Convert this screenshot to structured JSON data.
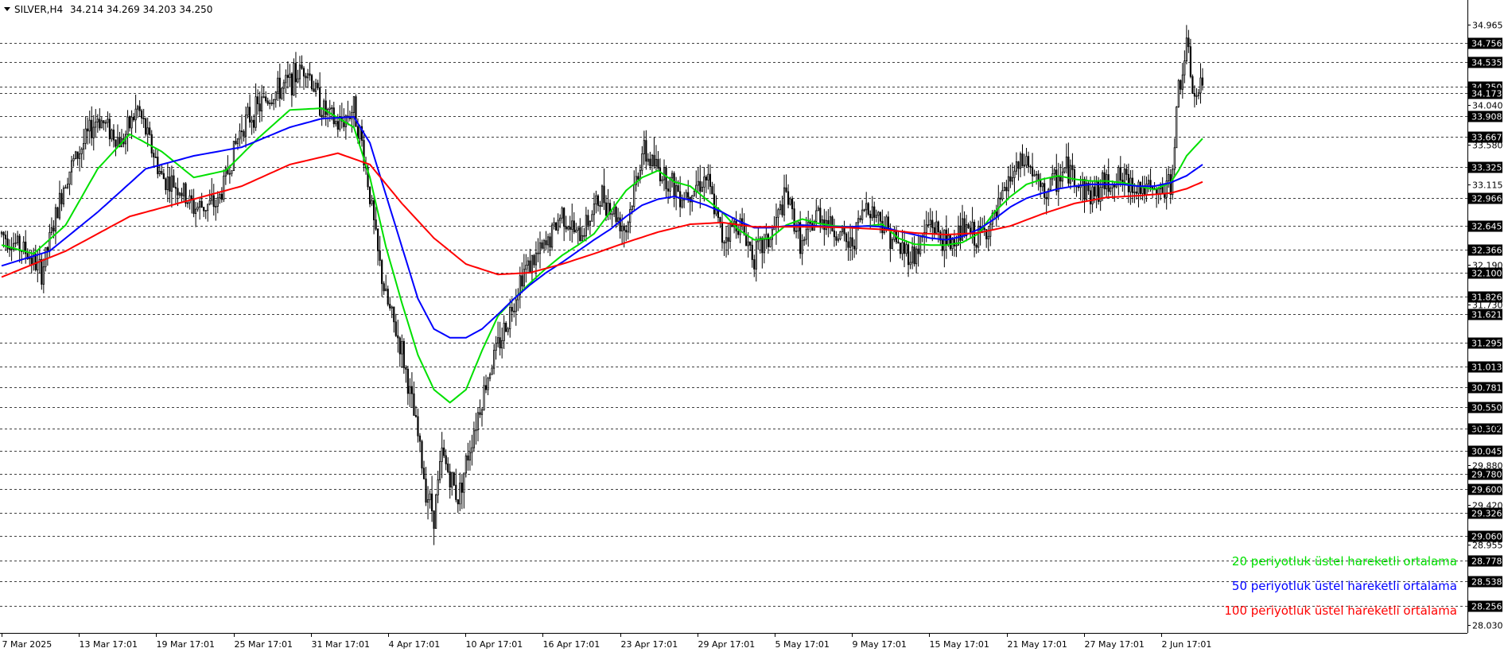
{
  "header": {
    "symbol": "SILVER,H4",
    "ohlc": "34.214 34.269 34.203 34.250"
  },
  "colors": {
    "ema20": "#00e000",
    "ema50": "#0000ff",
    "ema100": "#ff0000",
    "candle": "#000000",
    "grid": "#000000",
    "label_bg": "#000000"
  },
  "chart_data": {
    "type": "candlestick",
    "title": "SILVER,H4",
    "ylim": [
      27.94,
      35.25
    ],
    "grid": true,
    "price_ticks": [
      "34.965",
      "34.040",
      "33.580",
      "33.115",
      "32.190",
      "31.730",
      "30.315",
      "29.880",
      "29.420",
      "28.955",
      "28.030"
    ],
    "level_lines": [
      "34.756",
      "34.535",
      "34.250",
      "34.173",
      "33.908",
      "33.667",
      "33.325",
      "32.966",
      "32.645",
      "32.366",
      "32.100",
      "31.826",
      "31.621",
      "31.295",
      "31.013",
      "30.781",
      "30.550",
      "30.302",
      "30.045",
      "29.780",
      "29.600",
      "29.326",
      "29.060",
      "28.778",
      "28.538",
      "28.256"
    ],
    "time_ticks": [
      "7 Mar 2025",
      "13 Mar 17:01",
      "19 Mar 17:01",
      "25 Mar 17:01",
      "31 Mar 17:01",
      "4 Apr 17:01",
      "10 Apr 17:01",
      "16 Apr 17:01",
      "23 Apr 17:01",
      "29 Apr 17:01",
      "5 May 17:01",
      "9 May 17:01",
      "15 May 17:01",
      "21 May 17:01",
      "27 May 17:01",
      "2 Jun 17:01"
    ],
    "price_path": [
      [
        0,
        32.55
      ],
      [
        3,
        32.35
      ],
      [
        5,
        32.1
      ],
      [
        8,
        33.2
      ],
      [
        12,
        33.9
      ],
      [
        15,
        33.6
      ],
      [
        17,
        34.0
      ],
      [
        20,
        33.2
      ],
      [
        22,
        33.1
      ],
      [
        24,
        32.85
      ],
      [
        27,
        32.9
      ],
      [
        30,
        33.8
      ],
      [
        33,
        34.1
      ],
      [
        36,
        34.3
      ],
      [
        38,
        34.5
      ],
      [
        40,
        34.0
      ],
      [
        42,
        33.8
      ],
      [
        44,
        34.0
      ],
      [
        45,
        33.6
      ],
      [
        46,
        33.0
      ],
      [
        47,
        32.3
      ],
      [
        48,
        31.8
      ],
      [
        50,
        31.2
      ],
      [
        52,
        30.2
      ],
      [
        53,
        29.6
      ],
      [
        54,
        29.3
      ],
      [
        55,
        30.0
      ],
      [
        57,
        29.5
      ],
      [
        59,
        30.3
      ],
      [
        61,
        31.0
      ],
      [
        63,
        31.5
      ],
      [
        65,
        32.1
      ],
      [
        68,
        32.4
      ],
      [
        70,
        32.8
      ],
      [
        72,
        32.5
      ],
      [
        75,
        33.0
      ],
      [
        78,
        32.6
      ],
      [
        80,
        33.5
      ],
      [
        82,
        33.3
      ],
      [
        85,
        33.0
      ],
      [
        88,
        33.2
      ],
      [
        90,
        32.5
      ],
      [
        92,
        32.7
      ],
      [
        94,
        32.3
      ],
      [
        96,
        32.5
      ],
      [
        98,
        33.0
      ],
      [
        100,
        32.4
      ],
      [
        102,
        32.8
      ],
      [
        104,
        32.6
      ],
      [
        106,
        32.4
      ],
      [
        108,
        32.9
      ],
      [
        110,
        32.7
      ],
      [
        112,
        32.4
      ],
      [
        114,
        32.3
      ],
      [
        116,
        32.7
      ],
      [
        118,
        32.4
      ],
      [
        120,
        32.6
      ],
      [
        122,
        32.5
      ],
      [
        124,
        32.7
      ],
      [
        126,
        33.2
      ],
      [
        128,
        33.4
      ],
      [
        130,
        33.0
      ],
      [
        133,
        33.3
      ],
      [
        136,
        33.0
      ],
      [
        139,
        33.2
      ],
      [
        142,
        33.1
      ],
      [
        144,
        33.0
      ],
      [
        146,
        33.1
      ],
      [
        147,
        34.2
      ],
      [
        148,
        34.7
      ],
      [
        149,
        34.1
      ],
      [
        150,
        34.25
      ]
    ],
    "ema_series": [
      {
        "name": "20 periyotluk üstel hareketli ortalama",
        "color": "#00e000",
        "points": [
          [
            0,
            32.42
          ],
          [
            4,
            32.32
          ],
          [
            8,
            32.65
          ],
          [
            12,
            33.3
          ],
          [
            16,
            33.7
          ],
          [
            20,
            33.5
          ],
          [
            24,
            33.2
          ],
          [
            28,
            33.28
          ],
          [
            32,
            33.65
          ],
          [
            36,
            33.98
          ],
          [
            40,
            34.0
          ],
          [
            44,
            33.78
          ],
          [
            46,
            33.2
          ],
          [
            48,
            32.4
          ],
          [
            50,
            31.75
          ],
          [
            52,
            31.15
          ],
          [
            54,
            30.75
          ],
          [
            56,
            30.6
          ],
          [
            58,
            30.75
          ],
          [
            60,
            31.2
          ],
          [
            62,
            31.6
          ],
          [
            64,
            31.8
          ],
          [
            66,
            31.98
          ],
          [
            68,
            32.15
          ],
          [
            70,
            32.3
          ],
          [
            72,
            32.42
          ],
          [
            74,
            32.55
          ],
          [
            76,
            32.8
          ],
          [
            78,
            33.05
          ],
          [
            80,
            33.2
          ],
          [
            82,
            33.28
          ],
          [
            84,
            33.15
          ],
          [
            86,
            33.1
          ],
          [
            88,
            32.95
          ],
          [
            90,
            32.8
          ],
          [
            92,
            32.6
          ],
          [
            94,
            32.48
          ],
          [
            96,
            32.5
          ],
          [
            98,
            32.65
          ],
          [
            100,
            32.72
          ],
          [
            102,
            32.67
          ],
          [
            104,
            32.64
          ],
          [
            106,
            32.63
          ],
          [
            108,
            32.64
          ],
          [
            110,
            32.66
          ],
          [
            112,
            32.5
          ],
          [
            114,
            32.43
          ],
          [
            116,
            32.42
          ],
          [
            118,
            32.42
          ],
          [
            120,
            32.45
          ],
          [
            122,
            32.55
          ],
          [
            124,
            32.8
          ],
          [
            126,
            32.98
          ],
          [
            128,
            33.12
          ],
          [
            130,
            33.18
          ],
          [
            132,
            33.22
          ],
          [
            134,
            33.18
          ],
          [
            136,
            33.16
          ],
          [
            138,
            33.16
          ],
          [
            140,
            33.14
          ],
          [
            142,
            33.1
          ],
          [
            144,
            33.06
          ],
          [
            146,
            33.14
          ],
          [
            147,
            33.28
          ],
          [
            148,
            33.45
          ],
          [
            150,
            33.65
          ]
        ]
      },
      {
        "name": "50 periyotluk üstel hareketli ortalama",
        "color": "#0000ff",
        "points": [
          [
            0,
            32.18
          ],
          [
            6,
            32.35
          ],
          [
            12,
            32.8
          ],
          [
            18,
            33.3
          ],
          [
            24,
            33.45
          ],
          [
            30,
            33.55
          ],
          [
            36,
            33.78
          ],
          [
            40,
            33.88
          ],
          [
            44,
            33.9
          ],
          [
            46,
            33.6
          ],
          [
            48,
            33.0
          ],
          [
            50,
            32.4
          ],
          [
            52,
            31.8
          ],
          [
            54,
            31.45
          ],
          [
            56,
            31.35
          ],
          [
            58,
            31.35
          ],
          [
            60,
            31.45
          ],
          [
            62,
            31.62
          ],
          [
            64,
            31.8
          ],
          [
            66,
            31.96
          ],
          [
            68,
            32.1
          ],
          [
            70,
            32.22
          ],
          [
            72,
            32.35
          ],
          [
            74,
            32.48
          ],
          [
            76,
            32.6
          ],
          [
            78,
            32.75
          ],
          [
            80,
            32.88
          ],
          [
            82,
            32.95
          ],
          [
            84,
            32.98
          ],
          [
            86,
            32.94
          ],
          [
            88,
            32.88
          ],
          [
            90,
            32.8
          ],
          [
            92,
            32.7
          ],
          [
            94,
            32.62
          ],
          [
            96,
            32.62
          ],
          [
            98,
            32.64
          ],
          [
            100,
            32.65
          ],
          [
            102,
            32.64
          ],
          [
            104,
            32.63
          ],
          [
            106,
            32.63
          ],
          [
            108,
            32.64
          ],
          [
            110,
            32.63
          ],
          [
            112,
            32.58
          ],
          [
            114,
            32.54
          ],
          [
            116,
            32.5
          ],
          [
            118,
            32.48
          ],
          [
            120,
            32.52
          ],
          [
            122,
            32.6
          ],
          [
            124,
            32.72
          ],
          [
            126,
            32.86
          ],
          [
            128,
            32.96
          ],
          [
            130,
            33.02
          ],
          [
            132,
            33.07
          ],
          [
            134,
            33.1
          ],
          [
            136,
            33.12
          ],
          [
            138,
            33.12
          ],
          [
            140,
            33.12
          ],
          [
            142,
            33.1
          ],
          [
            144,
            33.1
          ],
          [
            146,
            33.14
          ],
          [
            148,
            33.22
          ],
          [
            150,
            33.35
          ]
        ]
      },
      {
        "name": "100 periyotluk üstel hareketli ortalama",
        "color": "#ff0000",
        "points": [
          [
            0,
            32.05
          ],
          [
            8,
            32.35
          ],
          [
            16,
            32.75
          ],
          [
            24,
            32.95
          ],
          [
            30,
            33.1
          ],
          [
            36,
            33.35
          ],
          [
            42,
            33.48
          ],
          [
            46,
            33.35
          ],
          [
            50,
            32.9
          ],
          [
            54,
            32.5
          ],
          [
            58,
            32.2
          ],
          [
            62,
            32.08
          ],
          [
            66,
            32.1
          ],
          [
            70,
            32.2
          ],
          [
            74,
            32.32
          ],
          [
            78,
            32.45
          ],
          [
            82,
            32.57
          ],
          [
            86,
            32.66
          ],
          [
            90,
            32.68
          ],
          [
            94,
            32.63
          ],
          [
            98,
            32.63
          ],
          [
            102,
            32.63
          ],
          [
            106,
            32.62
          ],
          [
            110,
            32.6
          ],
          [
            114,
            32.56
          ],
          [
            118,
            32.54
          ],
          [
            122,
            32.56
          ],
          [
            126,
            32.64
          ],
          [
            130,
            32.78
          ],
          [
            134,
            32.9
          ],
          [
            138,
            32.97
          ],
          [
            142,
            32.99
          ],
          [
            146,
            33.02
          ],
          [
            148,
            33.07
          ],
          [
            150,
            33.15
          ]
        ]
      }
    ],
    "legend_position": "bottom-right"
  }
}
